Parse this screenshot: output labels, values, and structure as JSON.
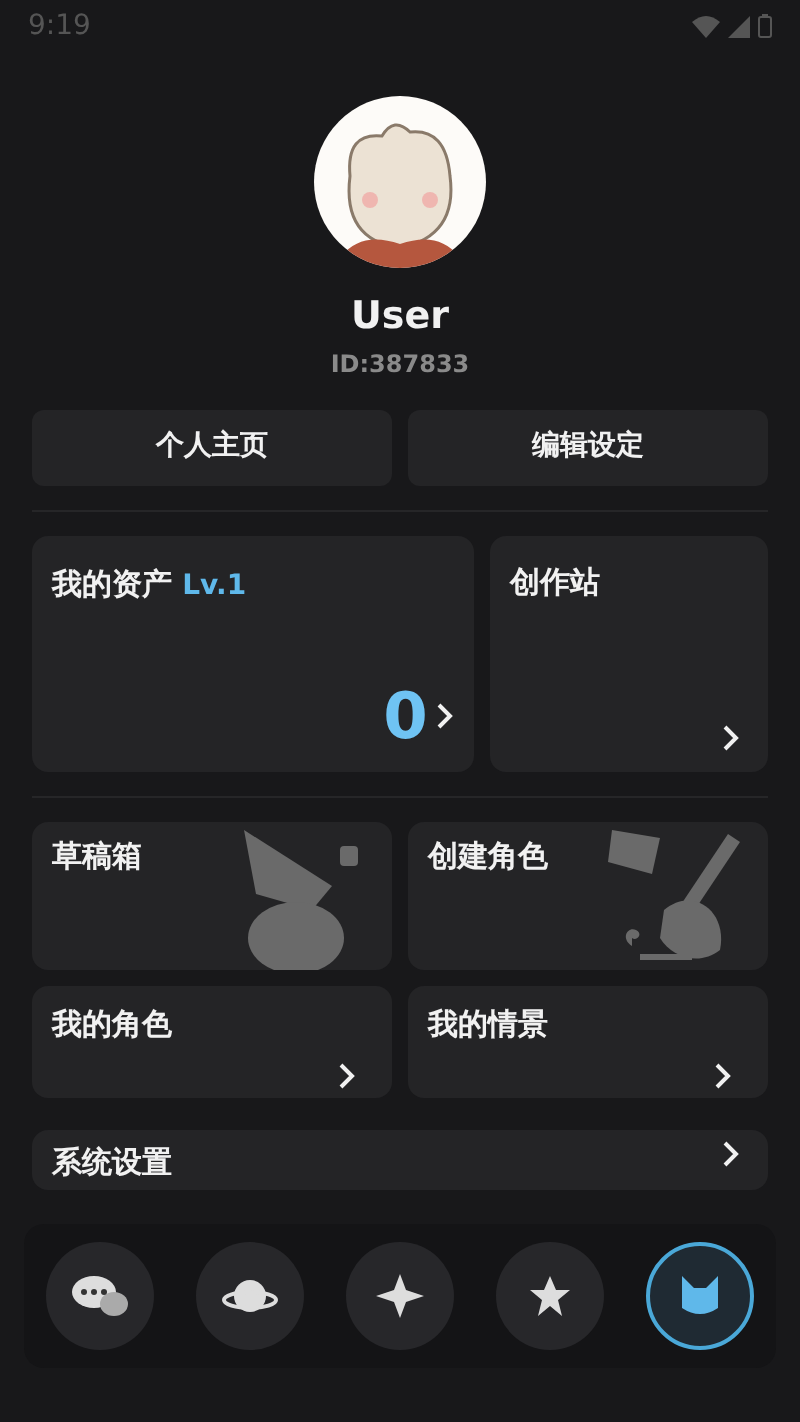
{
  "status_bar": {
    "time": "9:19"
  },
  "profile": {
    "name": "User",
    "id": "ID:387833"
  },
  "profile_buttons": [
    "个人主页",
    "编辑设定"
  ],
  "assets": {
    "title": "我的资产",
    "level": "Lv.1",
    "value": "0"
  },
  "studio": {
    "title": "创作站"
  },
  "tiles": [
    {
      "title": "草稿箱",
      "kind": "drafts"
    },
    {
      "title": "创建角色",
      "kind": "create"
    },
    {
      "title": "我的角色",
      "kind": "arrow"
    },
    {
      "title": "我的情景",
      "kind": "arrow"
    }
  ],
  "settings_row": {
    "title": "系统设置"
  },
  "bottom_nav": [
    {
      "kind": "chat",
      "selected": false
    },
    {
      "kind": "planet",
      "selected": false
    },
    {
      "kind": "ai-spark",
      "selected": false
    },
    {
      "kind": "ai",
      "selected": false
    },
    {
      "kind": "cat",
      "selected": true
    }
  ]
}
